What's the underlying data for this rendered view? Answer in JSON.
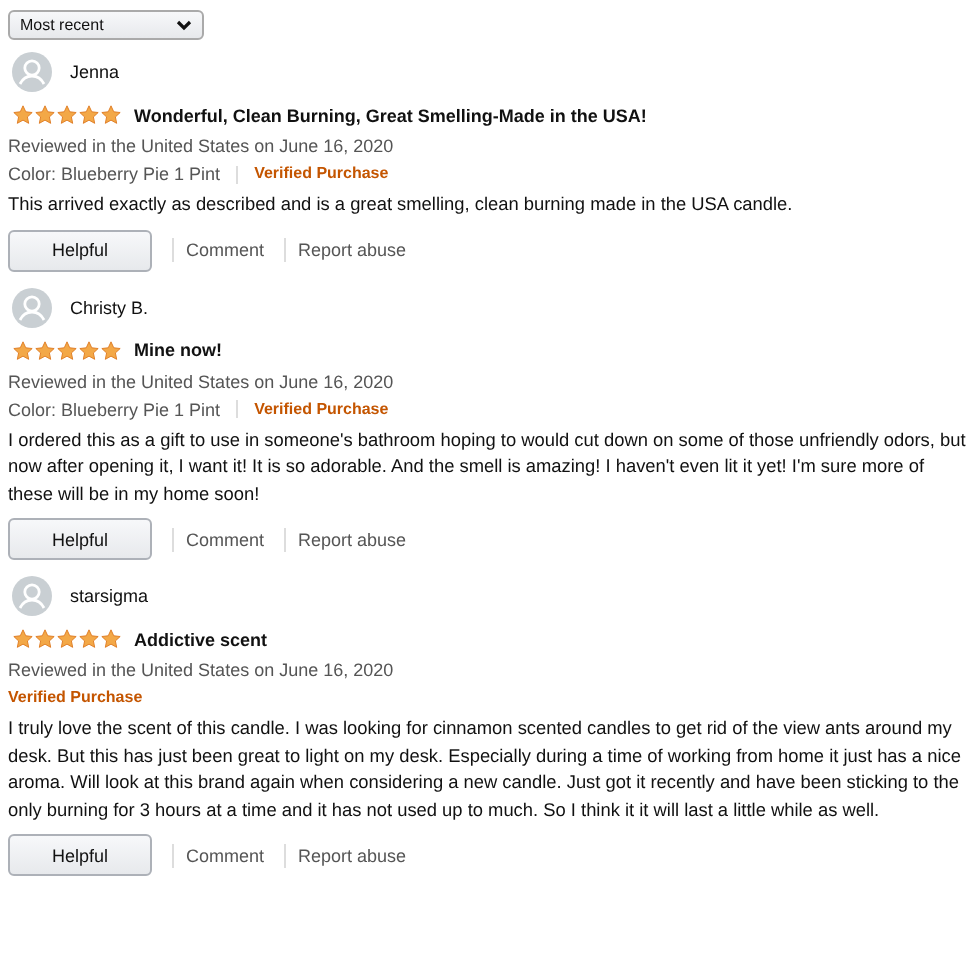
{
  "sort_dropdown": {
    "value": "Most recent"
  },
  "reviews": [
    {
      "author": "Jenna",
      "stars": 5,
      "title": "Wonderful, Clean Burning, Great Smelling-Made in the USA!",
      "reviewed": "Reviewed in the United States on June 16, 2020",
      "variant": "Color: Blueberry Pie 1 Pint",
      "verified": "Verified Purchase",
      "body": "This arrived exactly as described and is a great smelling, clean burning made in the USA candle.",
      "actions": [
        "Helpful",
        "Comment",
        "Report abuse"
      ]
    },
    {
      "author": "Christy B.",
      "stars": 5,
      "title": "Mine now!",
      "reviewed": "Reviewed in the United States on June 16, 2020",
      "variant": "Color: Blueberry Pie 1 Pint",
      "verified": "Verified Purchase",
      "body": "I ordered this as a gift to use in someone's bathroom hoping to would cut down on some of those unfriendly odors, but now after opening it, I want it! It is so adorable. And the smell is amazing! I haven't even lit it yet! I'm sure more of these will be in my home soon!",
      "actions": [
        "Helpful",
        "Comment",
        "Report abuse"
      ]
    },
    {
      "author": "starsigma",
      "stars": 5,
      "title": "Addictive scent",
      "reviewed": "Reviewed in the United States on June 16, 2020",
      "verified": "Verified Purchase",
      "body": "I truly love the scent of this candle. I was looking for cinnamon scented candles to get rid of the view ants around my desk. But this has just been great to light on my desk. Especially during a time of working from home it just has a nice aroma. Will look at this brand again when considering a new candle. Just got it recently and have been sticking to the only burning for 3 hours at a time and it has not used up to much. So I think it it will last a little while as well.",
      "actions": [
        "Helpful",
        "Comment",
        "Report abuse"
      ]
    }
  ]
}
